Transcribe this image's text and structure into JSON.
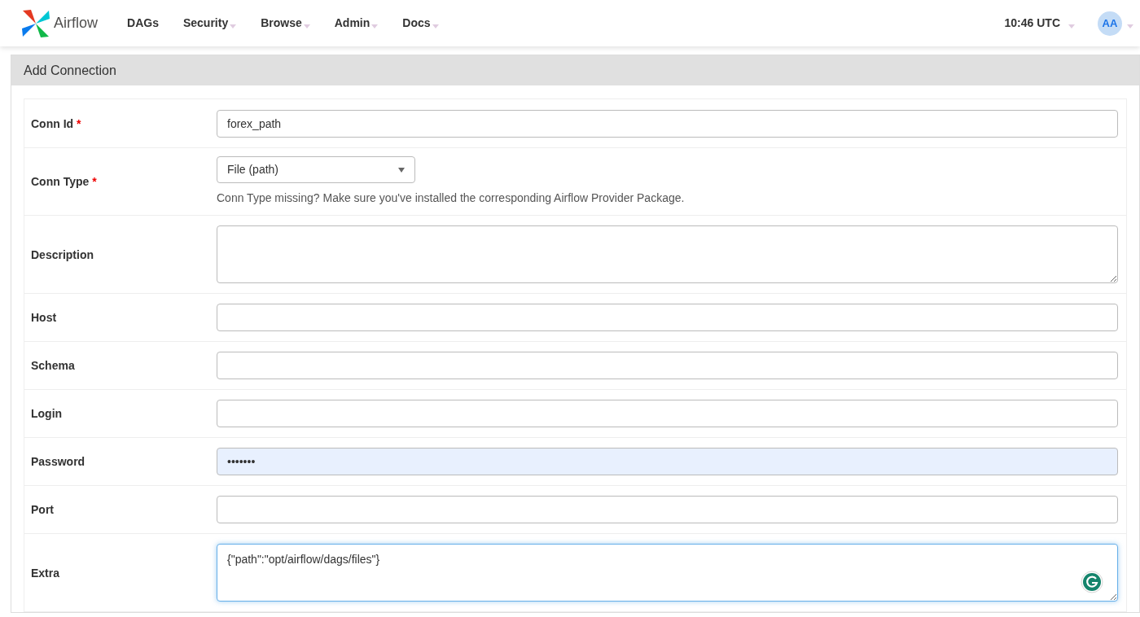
{
  "navbar": {
    "brand": "Airflow",
    "menu": [
      {
        "label": "DAGs",
        "dropdown": false
      },
      {
        "label": "Security",
        "dropdown": true
      },
      {
        "label": "Browse",
        "dropdown": true
      },
      {
        "label": "Admin",
        "dropdown": true
      },
      {
        "label": "Docs",
        "dropdown": true
      }
    ],
    "clock": "10:46 UTC",
    "avatar": "AA"
  },
  "panel": {
    "title": "Add Connection"
  },
  "required_mark": "*",
  "fields": [
    {
      "label": "Conn Id",
      "required": true,
      "kind": "text",
      "value": "forex_path"
    },
    {
      "label": "Conn Type",
      "required": true,
      "kind": "select",
      "value": "File (path)",
      "help": "Conn Type missing? Make sure you've installed the corresponding Airflow Provider Package."
    },
    {
      "label": "Description",
      "required": false,
      "kind": "textarea"
    },
    {
      "label": "Host",
      "required": false,
      "kind": "text"
    },
    {
      "label": "Schema",
      "required": false,
      "kind": "text"
    },
    {
      "label": "Login",
      "required": false,
      "kind": "text"
    },
    {
      "label": "Password",
      "required": false,
      "kind": "text",
      "value": "•••••••",
      "autofilled": true
    },
    {
      "label": "Port",
      "required": false,
      "kind": "text"
    },
    {
      "label": "Extra",
      "required": false,
      "kind": "textarea",
      "value": "{\"path\":\"opt/airflow/dags/files\"}",
      "focused": true,
      "grammar_badge": true
    }
  ]
}
